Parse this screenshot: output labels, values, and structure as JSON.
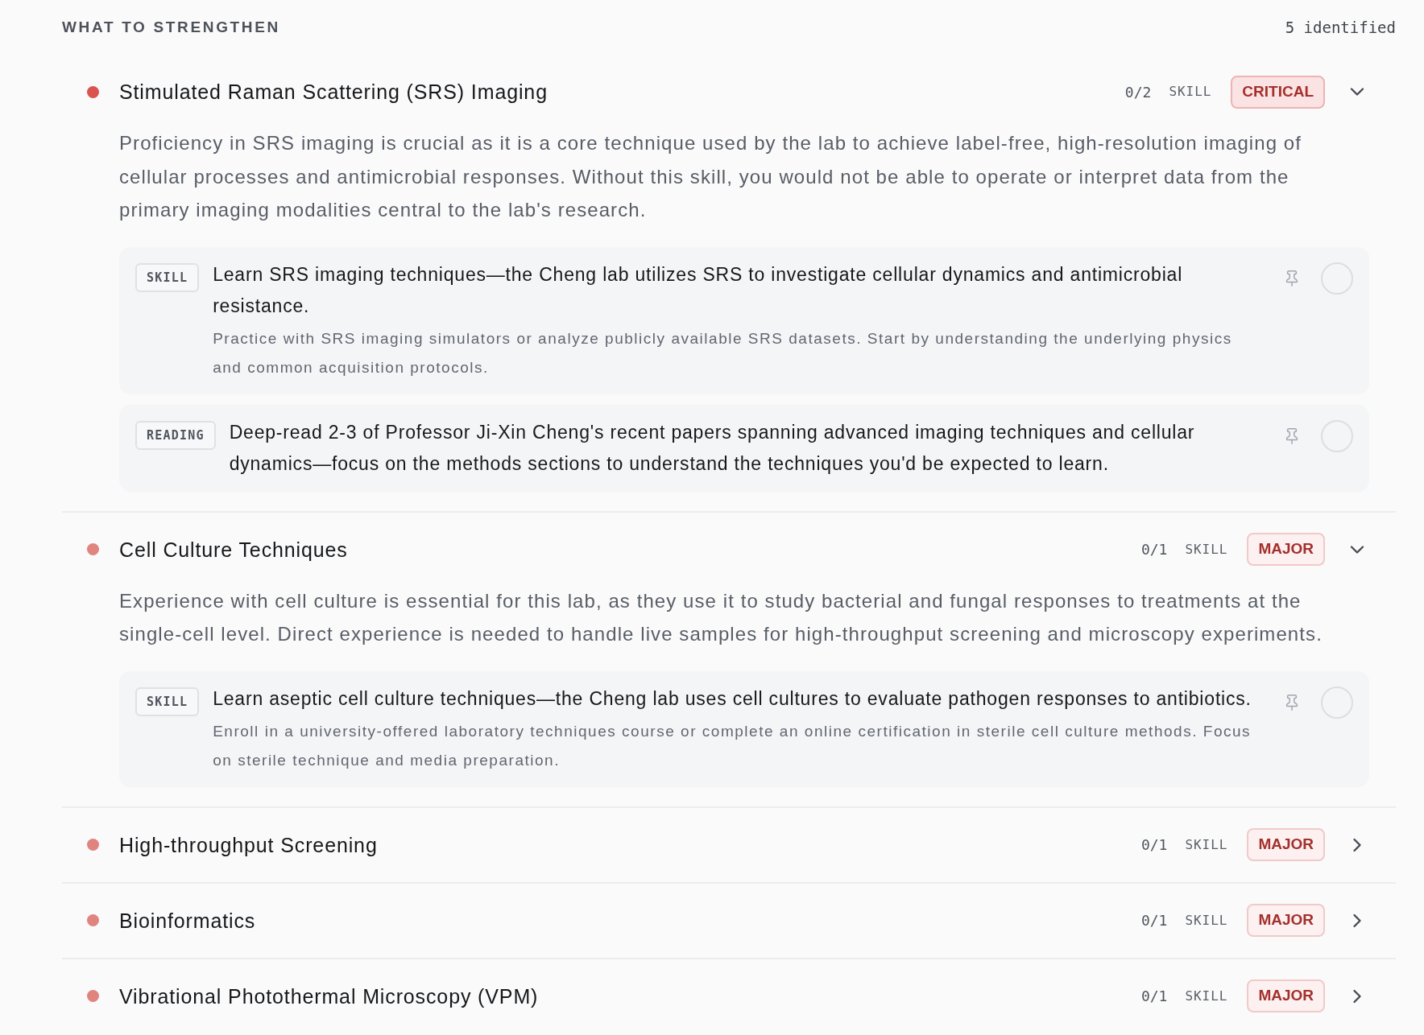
{
  "header": {
    "title": "WHAT TO STRENGTHEN",
    "count": "5 identified"
  },
  "gaps": [
    {
      "title": "Stimulated Raman Scattering (SRS) Imaging",
      "color": "#d9544e",
      "progress": "0/2",
      "type": "SKILL",
      "kind": "critical",
      "badge": "CRITICAL",
      "expanded": true,
      "description": "Proficiency in SRS imaging is crucial as it is a core technique used by the lab to achieve label-free, high-resolution imaging of cellular processes and antimicrobial responses. Without this skill, you would not be able to operate or interpret data from the primary imaging modalities central to the lab's research.",
      "actions": [
        {
          "tag": "SKILL",
          "title": "Learn SRS imaging techniques—the Cheng lab utilizes SRS to investigate cellular dynamics and antimicrobial resistance.",
          "detail": "Practice with SRS imaging simulators or analyze publicly available SRS datasets. Start by understanding the underlying physics and common acquisition protocols.",
          "checked": false
        },
        {
          "tag": "READING",
          "title": "Deep-read 2-3 of Professor Ji-Xin Cheng's recent papers spanning advanced imaging techniques and cellular dynamics—focus on the methods sections to understand the techniques you'd be expected to learn.",
          "checked": false
        }
      ]
    },
    {
      "title": "Cell Culture Techniques",
      "color": "#e08480",
      "progress": "0/1",
      "type": "SKILL",
      "kind": "major",
      "badge": "MAJOR",
      "expanded": true,
      "description": "Experience with cell culture is essential for this lab, as they use it to study bacterial and fungal responses to treatments at the single-cell level. Direct experience is needed to handle live samples for high-throughput screening and microscopy experiments.",
      "actions": [
        {
          "tag": "SKILL",
          "title": "Learn aseptic cell culture techniques—the Cheng lab uses cell cultures to evaluate pathogen responses to antibiotics.",
          "detail": "Enroll in a university-offered laboratory techniques course or complete an online certification in sterile cell culture methods. Focus on sterile technique and media preparation.",
          "checked": false
        }
      ]
    },
    {
      "title": "High-throughput Screening",
      "color": "#e08480",
      "progress": "0/1",
      "type": "SKILL",
      "kind": "major",
      "badge": "MAJOR",
      "expanded": false
    },
    {
      "title": "Bioinformatics",
      "color": "#e08480",
      "progress": "0/1",
      "type": "SKILL",
      "kind": "major",
      "badge": "MAJOR",
      "expanded": false
    },
    {
      "title": "Vibrational Photothermal Microscopy (VPM)",
      "color": "#e08480",
      "progress": "0/1",
      "type": "SKILL",
      "kind": "major",
      "badge": "MAJOR",
      "expanded": false
    }
  ]
}
